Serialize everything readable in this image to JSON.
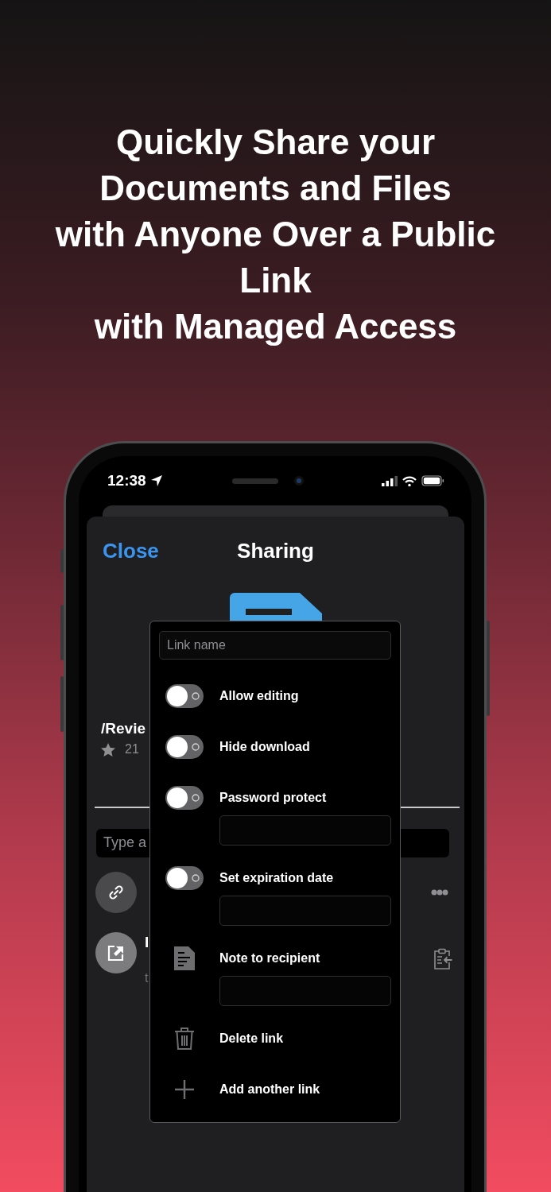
{
  "headline": "Quickly Share your\nDocuments and Files\nwith Anyone Over a Public\nLink\nwith Managed Access",
  "status_bar": {
    "time": "12:38"
  },
  "sheet": {
    "close": "Close",
    "title": "Sharing",
    "file": {
      "path": "/Revie",
      "size": "21"
    },
    "share_field": {
      "placeholder": "Type a"
    },
    "shares": [
      {
        "kind": "link"
      },
      {
        "kind": "internal",
        "title": "I",
        "subtitle": "t"
      }
    ]
  },
  "link_menu": {
    "name_field": {
      "placeholder": "Link name"
    },
    "items": [
      {
        "kind": "toggle",
        "label": "Allow editing",
        "on": false
      },
      {
        "kind": "toggle",
        "label": "Hide download",
        "on": false
      },
      {
        "kind": "toggle",
        "label": "Password protect",
        "on": false,
        "has_field": true
      },
      {
        "kind": "toggle",
        "label": "Set expiration date",
        "on": false,
        "has_field": true
      },
      {
        "kind": "note",
        "label": "Note to recipient",
        "has_field": true
      },
      {
        "kind": "delete",
        "label": "Delete link"
      },
      {
        "kind": "add",
        "label": "Add another link"
      }
    ]
  }
}
